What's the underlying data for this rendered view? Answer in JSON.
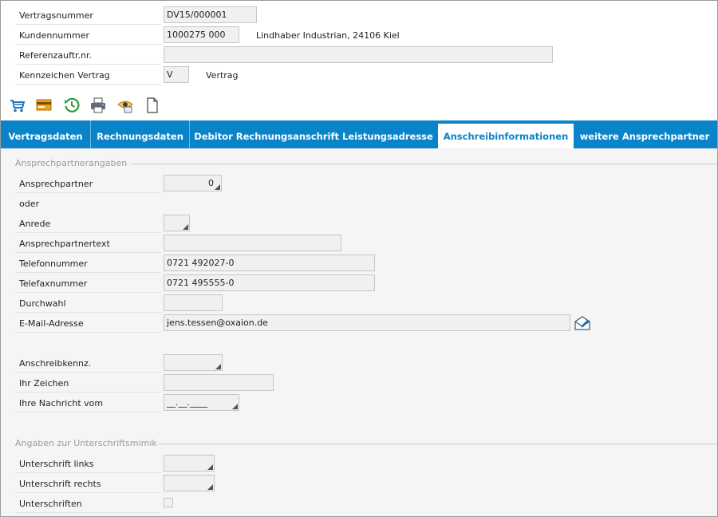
{
  "header": {
    "vertragsnummer": {
      "label": "Vertragsnummer",
      "value": "DV15/000001"
    },
    "kundennummer": {
      "label": "Kundennummer",
      "value": "1000275 000",
      "name": "Lindhaber Industrian, 24106 Kiel"
    },
    "referenz": {
      "label": "Referenzauftr.nr.",
      "value": ""
    },
    "kennzeichen": {
      "label": "Kennzeichen Vertrag",
      "value": "V",
      "text": "Vertrag"
    }
  },
  "toolbar": {
    "icons": [
      "cart-icon",
      "card-icon",
      "history-icon",
      "print-icon",
      "preview-icon",
      "document-icon"
    ]
  },
  "tabs": [
    {
      "label": "Vertragsdaten"
    },
    {
      "label": "Rechnungsdaten"
    },
    {
      "label": "Debitor Rechnungsanschrift Leistungsadresse"
    },
    {
      "label": "Anschreibinformationen"
    },
    {
      "label": "weitere Ansprechpartner"
    }
  ],
  "active_tab": "Anschreibinformationen",
  "section1": {
    "title": "Ansprechpartnerangaben",
    "ansprechpartner": {
      "label": "Ansprechpartner",
      "value": "0"
    },
    "oder": "oder",
    "anrede": {
      "label": "Anrede",
      "value": ""
    },
    "ansprechpartnertext": {
      "label": "Ansprechpartnertext",
      "value": ""
    },
    "telefon": {
      "label": "Telefonnummer",
      "value": "0721 492027-0"
    },
    "telefax": {
      "label": "Telefaxnummer",
      "value": "0721 495555-0"
    },
    "durchwahl": {
      "label": "Durchwahl",
      "value": ""
    },
    "email": {
      "label": "E-Mail-Adresse",
      "value": "jens.tessen@oxaion.de"
    },
    "anschreibkennz": {
      "label": "Anschreibkennz.",
      "value": ""
    },
    "ihr_zeichen": {
      "label": "Ihr Zeichen",
      "value": ""
    },
    "nachricht": {
      "label": "Ihre Nachricht vom",
      "value": "__.__.____"
    }
  },
  "section2": {
    "title": "Angaben zur Unterschriftsmimik",
    "links": {
      "label": "Unterschrift links",
      "value": ""
    },
    "rechts": {
      "label": "Unterschrift rechts",
      "value": ""
    },
    "unterschriften": {
      "label": "Unterschriften",
      "checked": false
    }
  },
  "colors": {
    "accent": "#0a84c9"
  }
}
